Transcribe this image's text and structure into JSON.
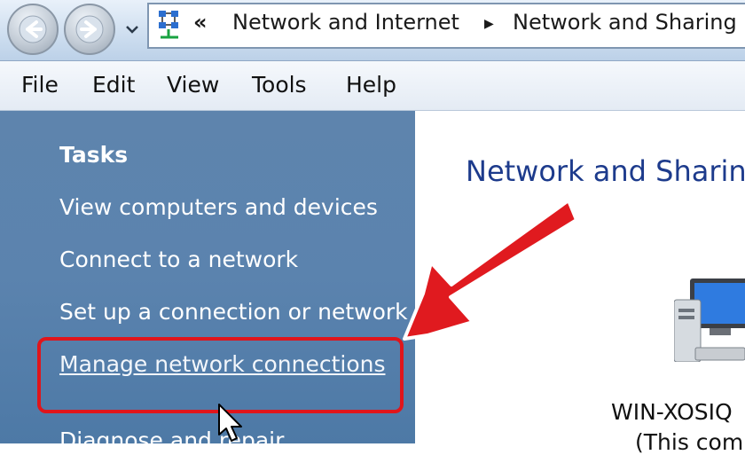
{
  "address_bar": {
    "overflow_chevron": "«",
    "breadcrumbs": [
      "Network and Internet",
      "Network and Sharing"
    ],
    "separator": "▶"
  },
  "menu": [
    "File",
    "Edit",
    "View",
    "Tools",
    "Help"
  ],
  "tasks": {
    "heading": "Tasks",
    "items": [
      "View computers and devices",
      "Connect to a network",
      "Set up a connection or network",
      "Manage network connections",
      "Diagnose and repair"
    ],
    "highlighted_index": 3
  },
  "content": {
    "title": "Network and Sharin",
    "computer_name": "WIN-XOSIQ",
    "computer_sub": "(This com"
  },
  "colors": {
    "highlight": "#e0151b",
    "pane": "#5a82ad",
    "title": "#1d3b8c"
  },
  "icons": [
    "back-icon",
    "forward-icon",
    "network-icon",
    "computer-icon",
    "mouse-pointer-icon",
    "arrow-annotation"
  ]
}
